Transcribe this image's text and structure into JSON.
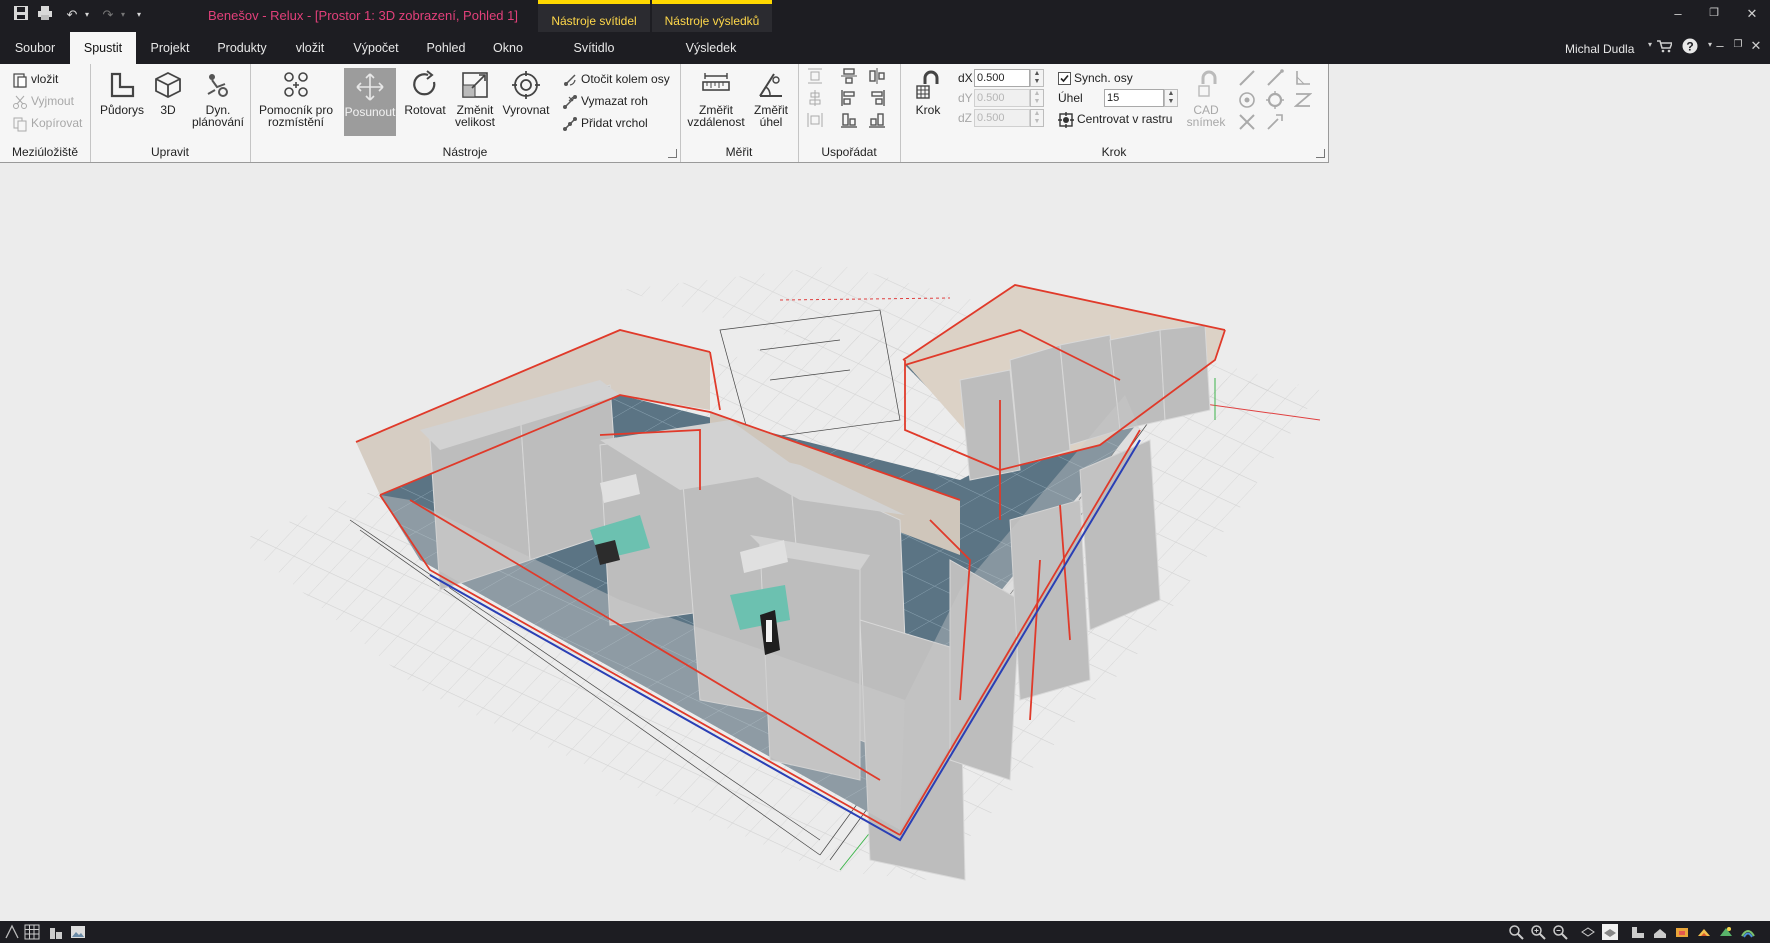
{
  "window": {
    "title": "Benešov - Relux - [Prostor 1: 3D zobrazení, Pohled 1]",
    "context_tabs": [
      "Nástroje svítidel",
      "Nástroje výsledků"
    ]
  },
  "menu": {
    "tabs": [
      "Soubor",
      "Spustit",
      "Projekt",
      "Produkty",
      "vložit",
      "Výpočet",
      "Pohled",
      "Okno",
      "Svítidlo",
      "Výsledek"
    ],
    "active_tab": "Spustit",
    "user": "Michal Dudla"
  },
  "ribbon": {
    "clipboard": {
      "label": "Meziúložiště",
      "paste": "vložit",
      "cut": "Vyjmout",
      "copy": "Kopírovat"
    },
    "edit": {
      "label": "Upravit",
      "floorplan": "Půdorys",
      "view3d": "3D",
      "dyn1": "Dyn.",
      "dyn2": "plánování"
    },
    "tools": {
      "label": "Nástroje",
      "helper1": "Pomocník pro",
      "helper2": "rozmístění",
      "move": "Posunout",
      "rotate": "Rotovat",
      "resize1": "Změnit",
      "resize2": "velikost",
      "align": "Vyrovnat",
      "rotate_axis": "Otočit kolem osy",
      "delete_corner": "Vymazat roh",
      "add_vertex": "Přidat vrchol"
    },
    "measure": {
      "label": "Měřit",
      "dist1": "Změřit",
      "dist2": "vzdálenost",
      "angle1": "Změřit",
      "angle2": "úhel"
    },
    "arrange": {
      "label": "Uspořádat"
    },
    "step": {
      "label": "Krok",
      "step_button": "Krok",
      "dx_label": "dX",
      "dx_value": "0.500",
      "dy_label": "dY",
      "dy_value": "0.500",
      "dz_label": "dZ",
      "dz_value": "0.500",
      "sync": "Synch. osy",
      "angle_label": "Úhel",
      "angle_value": "15",
      "center": "Centrovat v rastru",
      "cad1": "CAD",
      "cad2": "snímek"
    }
  }
}
